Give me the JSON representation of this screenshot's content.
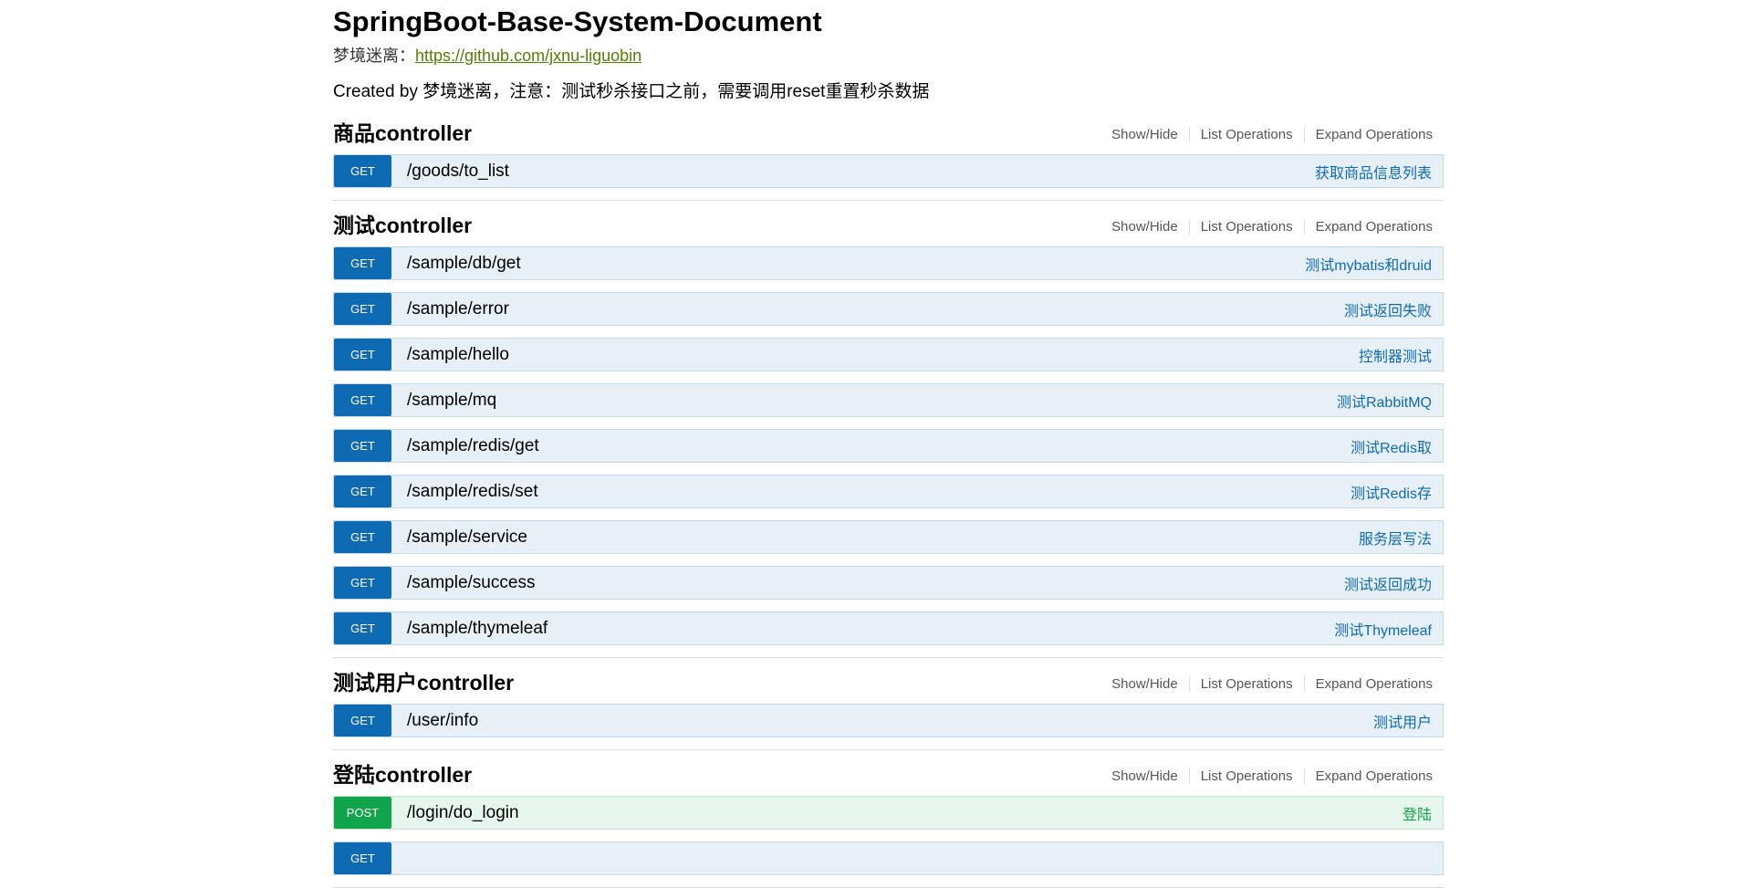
{
  "title": "SpringBoot-Base-System-Document",
  "info": {
    "author_label": "梦境迷离：",
    "link": "https://github.com/jxnu-liguobin"
  },
  "description": "Created by 梦境迷离，注意：测试秒杀接口之前，需要调用reset重置秒杀数据",
  "ops": {
    "show_hide": "Show/Hide",
    "list": "List Operations",
    "expand": "Expand Operations"
  },
  "colors": {
    "get": "#0f6ab4",
    "post": "#10a54a",
    "link": "#547f00"
  },
  "sections": [
    {
      "name": "商品controller",
      "endpoints": [
        {
          "method": "GET",
          "path": "/goods/to_list",
          "summary": "获取商品信息列表"
        }
      ]
    },
    {
      "name": "测试controller",
      "endpoints": [
        {
          "method": "GET",
          "path": "/sample/db/get",
          "summary": "测试mybatis和druid"
        },
        {
          "method": "GET",
          "path": "/sample/error",
          "summary": "测试返回失败"
        },
        {
          "method": "GET",
          "path": "/sample/hello",
          "summary": "控制器测试"
        },
        {
          "method": "GET",
          "path": "/sample/mq",
          "summary": "测试RabbitMQ"
        },
        {
          "method": "GET",
          "path": "/sample/redis/get",
          "summary": "测试Redis取"
        },
        {
          "method": "GET",
          "path": "/sample/redis/set",
          "summary": "测试Redis存"
        },
        {
          "method": "GET",
          "path": "/sample/service",
          "summary": "服务层写法"
        },
        {
          "method": "GET",
          "path": "/sample/success",
          "summary": "测试返回成功"
        },
        {
          "method": "GET",
          "path": "/sample/thymeleaf",
          "summary": "测试Thymeleaf"
        }
      ]
    },
    {
      "name": "测试用户controller",
      "endpoints": [
        {
          "method": "GET",
          "path": "/user/info",
          "summary": "测试用户"
        }
      ]
    },
    {
      "name": "登陆controller",
      "endpoints": [
        {
          "method": "POST",
          "path": "/login/do_login",
          "summary": "登陆"
        },
        {
          "method": "GET",
          "path": "",
          "summary": ""
        }
      ]
    }
  ]
}
